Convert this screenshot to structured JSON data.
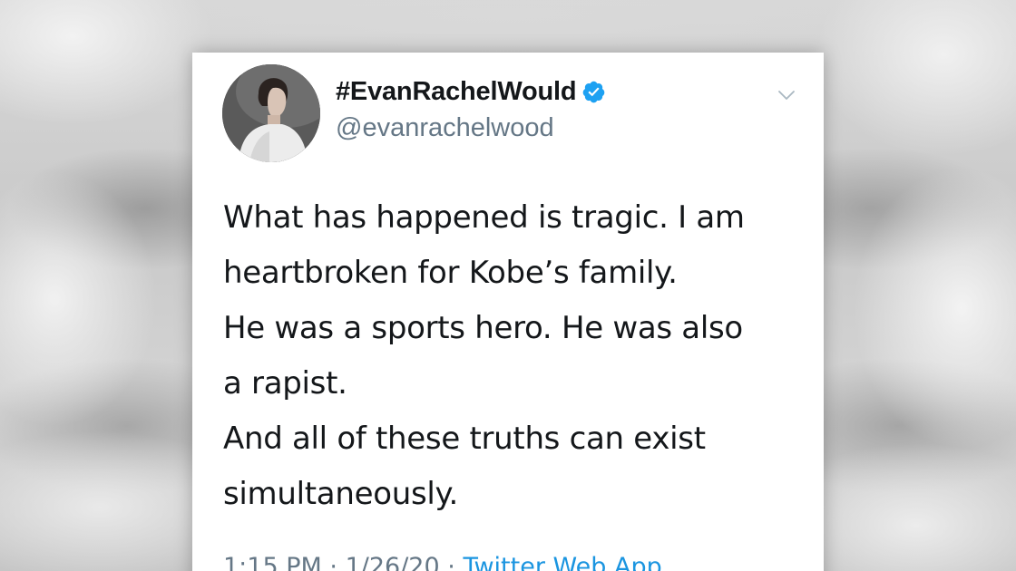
{
  "tweet": {
    "display_name": "#EvanRachelWould",
    "verified": true,
    "handle": "@evanrachelwood",
    "text_lines": [
      "What has happened is tragic. I am",
      "heartbroken for Kobe’s family.",
      "He was a sports hero. He was also",
      "a rapist.",
      "And all of these truths can exist",
      "simultaneously."
    ],
    "time": "1:15 PM",
    "separator": "·",
    "date": "1/26/20",
    "source": "Twitter Web App"
  },
  "icons": {
    "verified": "verified-badge-icon",
    "menu": "chevron-down-icon"
  },
  "colors": {
    "verified_blue": "#1da1f2",
    "text_primary": "#14171a",
    "text_secondary": "#657786",
    "link_blue": "#1b95e0"
  }
}
